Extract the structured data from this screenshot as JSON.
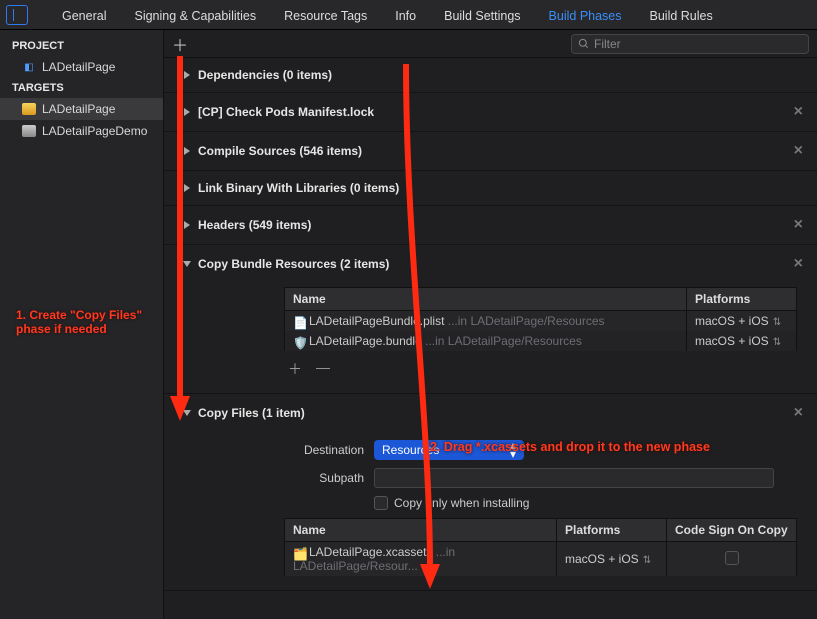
{
  "tabs": {
    "general": "General",
    "signing": "Signing & Capabilities",
    "resource": "Resource Tags",
    "info": "Info",
    "build_settings": "Build Settings",
    "build_phases": "Build Phases",
    "build_rules": "Build Rules"
  },
  "sidebar": {
    "project_header": "PROJECT",
    "project_name": "LADetailPage",
    "targets_header": "TARGETS",
    "targets": [
      {
        "label": "LADetailPage"
      },
      {
        "label": "LADetailPageDemo"
      }
    ]
  },
  "toolbar": {
    "filter_placeholder": "Filter"
  },
  "phases": {
    "dependencies": "Dependencies (0 items)",
    "cp_pods": "[CP] Check Pods Manifest.lock",
    "compile": "Compile Sources (546 items)",
    "link": "Link Binary With Libraries (0 items)",
    "headers": "Headers (549 items)",
    "copy_bundle": "Copy Bundle Resources (2 items)",
    "copy_files": "Copy Files (1 item)"
  },
  "cols": {
    "name": "Name",
    "platforms": "Platforms",
    "codesign": "Code Sign On Copy"
  },
  "cbr_rows": [
    {
      "name": "LADetailPageBundle.plist",
      "path": "...in LADetailPage/Resources",
      "platforms": "macOS + iOS"
    },
    {
      "name": "LADetailPage.bundle",
      "path": "...in LADetailPage/Resources",
      "platforms": "macOS + iOS"
    }
  ],
  "copy_form": {
    "destination_label": "Destination",
    "destination_value": "Resources",
    "subpath_label": "Subpath",
    "subpath_value": "",
    "copy_only_label": "Copy only when installing"
  },
  "cf_rows": [
    {
      "name": "LADetailPage.xcassets",
      "path": "...in LADetailPage/Resour...",
      "platforms": "macOS + iOS"
    }
  ],
  "annotations": {
    "a1_l1": "1. Create \"Copy Files\"",
    "a1_l2": "phase if needed",
    "a2": "2. Drag *.xcassets and drop it to the new phase"
  }
}
